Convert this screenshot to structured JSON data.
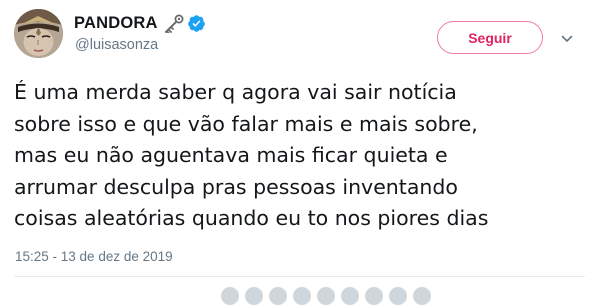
{
  "tweet": {
    "author": {
      "display_name": "PANDORA",
      "name_emoji": "old-key-icon",
      "verified": true,
      "handle": "@luisasonza"
    },
    "follow_button_label": "Seguir",
    "menu_icon": "chevron-down-icon",
    "text_lines": [
      "É uma merda saber q agora vai sair notícia",
      "sobre isso e que vão falar mais e mais sobre,",
      "mas eu não aguentava mais ficar quieta e",
      "arrumar desculpa pras pessoas inventando",
      "coisas aleatórias quando eu to nos piores dias"
    ],
    "timestamp": "15:25 - 13 de dez de 2019"
  },
  "colors": {
    "follow_accent": "#e0245e",
    "follow_border": "#f27aa3",
    "verified_badge": "#1da1f2",
    "secondary_text": "#657786",
    "primary_text": "#14171a"
  }
}
